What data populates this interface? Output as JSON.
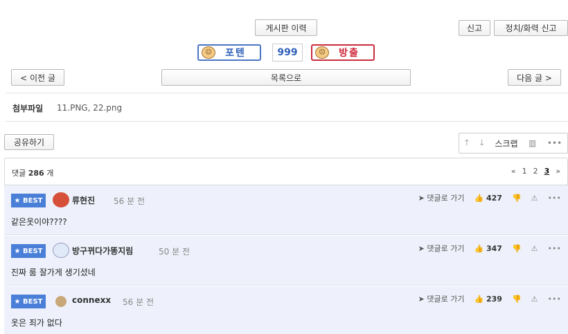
{
  "top": {
    "history_label": "게시판 이력",
    "report_label": "신고",
    "political_report_label": "정치/화력 신고"
  },
  "vote": {
    "up_label": "포텐",
    "down_label": "방출",
    "count": "999"
  },
  "nav": {
    "prev_label": "< 이전 글",
    "list_label": "목록으로",
    "next_label": "다음 글 >"
  },
  "attachments": {
    "label": "첨부파일",
    "files": "11.PNG,  22.png"
  },
  "share_label": "공유하기",
  "toolbar": {
    "scrap_label": "스크랩"
  },
  "comments_header": {
    "prefix": "댓글",
    "count": "286",
    "suffix": "개",
    "pages": [
      "1",
      "2",
      "3"
    ],
    "current_page": "3"
  },
  "comments": [
    {
      "badge": "BEST",
      "author": "류현진",
      "time": "56 분 전",
      "text": "같은옷이야????",
      "reply": "댓글로 가기",
      "likes": "427"
    },
    {
      "badge": "BEST",
      "author": "방구뀌다가똥지림",
      "time": "50 분 전",
      "text": "진짜 룸 잘가게 생기셨네",
      "reply": "댓글로 가기",
      "likes": "347"
    },
    {
      "badge": "BEST",
      "author": "connexx",
      "time": "56 분 전",
      "text": "옷은 죄가 없다",
      "reply": "댓글로 가기",
      "likes": "239"
    }
  ]
}
